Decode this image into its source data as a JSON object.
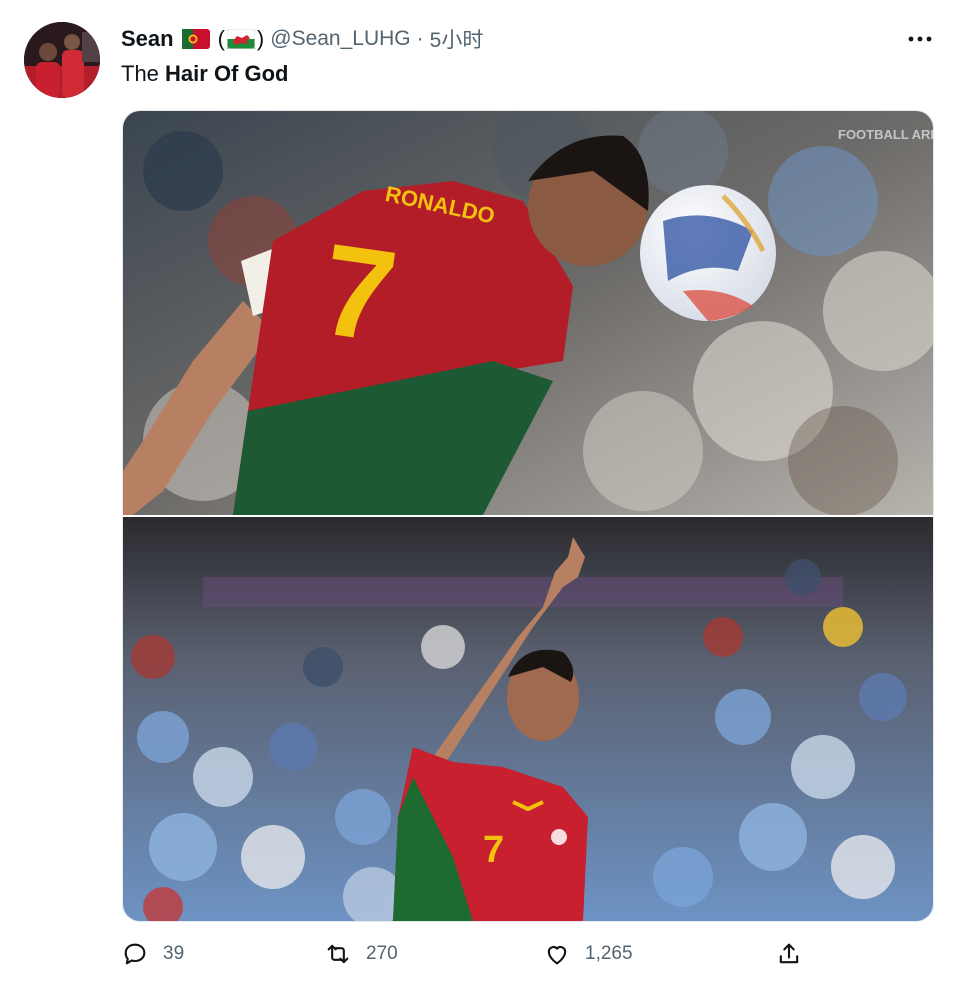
{
  "tweet": {
    "author_name": "Sean",
    "flag_1": "portugal-flag",
    "flag_2": "wales-flag",
    "paren_open": "(",
    "paren_close": ")",
    "handle": "@Sean_LUHG",
    "separator": "·",
    "time": "5小时",
    "text_prefix": "The ",
    "text_bold": "Hair Of God",
    "watermark": "FOOTBALL ARENA",
    "jersey_name": "RONALDO",
    "jersey_number": "7"
  },
  "actions": {
    "reply_count": "39",
    "retweet_count": "270",
    "like_count": "1,265"
  },
  "icons": [
    "more-icon",
    "reply-icon",
    "retweet-icon",
    "like-icon",
    "share-icon"
  ],
  "colors": {
    "text": "#0f1419",
    "muted": "#536471",
    "portugal_red": "#c8102e",
    "portugal_green": "#1e5a32",
    "jersey_yellow": "#f2c20f"
  }
}
